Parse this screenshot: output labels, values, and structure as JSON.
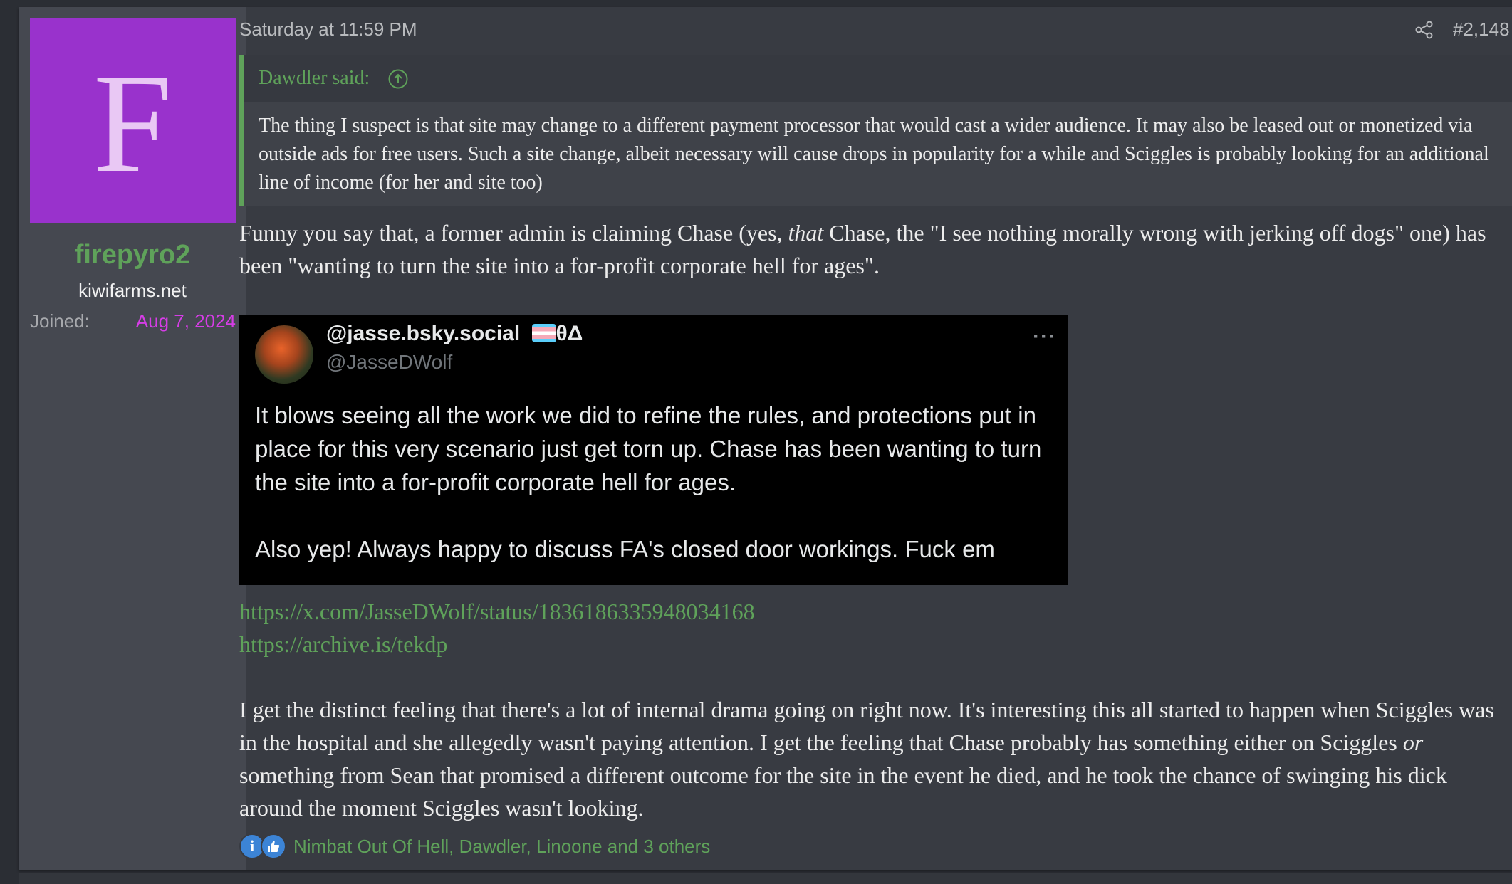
{
  "user": {
    "avatar_letter": "F",
    "avatar_color": "#9932cc",
    "username": "firepyro2",
    "title": "kiwifarms.net",
    "joined_label": "Joined:",
    "joined_date": "Aug 7, 2024"
  },
  "post": {
    "date": "Saturday at 11:59 PM",
    "number": "#2,148",
    "quote": {
      "author": "Dawdler said:",
      "text": "The thing I suspect is that site may change to a different payment processor that would cast a wider audience. It may also be leased out or monetized via outside ads for free users. Such a site change, albeit necessary will cause drops in popularity for a while and Sciggles is probably looking for an additional line of income (for her and site too)"
    },
    "para1_a": "Funny you say that, a former admin is claiming Chase (yes, ",
    "para1_em": "that",
    "para1_b": " Chase, the \"I see nothing morally wrong with jerking off dogs\" one) has been \"wanting to turn the site into a for-profit corporate hell for ages\".",
    "tweet": {
      "display_name": "@jasse.bsky.social",
      "name_suffix": "θΔ",
      "handle": "@JasseDWolf",
      "more": "···",
      "body": "It blows seeing all the work we did to refine the rules, and protections put in place for this very scenario just get torn up.  Chase has been wanting to turn the site into a for-profit corporate hell for ages.\n\nAlso yep! Always happy to discuss FA's closed door workings. Fuck em"
    },
    "links": [
      "https://x.com/JasseDWolf/status/1836186335948034168",
      "https://archive.is/tekdp"
    ],
    "para3_a": "I get the distinct feeling that there's a lot of internal drama going on right now. It's interesting this all started to happen when Sciggles was in the hospital and she allegedly wasn't paying attention. I get the feeling that Chase probably has something either on Sciggles ",
    "para3_em": "or",
    "para3_b": " something from Sean that promised a different outcome for the site in the event he died, and he took the chance of swinging his dick around the moment Sciggles wasn't looking.",
    "reactions": {
      "icons": [
        "informative-icon",
        "like-icon"
      ],
      "text": "Nimbat Out Of Hell, Dawdler, Linoone and 3 others"
    }
  },
  "colors": {
    "accent_green": "#5fa25a",
    "joined_magenta": "#d63de6",
    "reaction_blue": "#3c84d6"
  }
}
